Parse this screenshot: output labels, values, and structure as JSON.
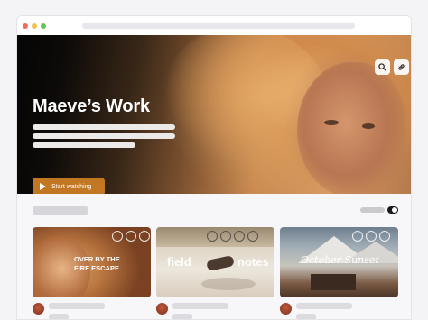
{
  "window": {
    "controls": [
      {
        "name": "close",
        "color": "#f36b5c"
      },
      {
        "name": "minimize",
        "color": "#f5bf4f"
      },
      {
        "name": "maximize",
        "color": "#5fc553"
      }
    ]
  },
  "hero": {
    "title": "Maeve’s Work",
    "cta_label": "Start watching",
    "accent": "#c27823",
    "icons": [
      "search-icon",
      "link-icon"
    ]
  },
  "cards": [
    {
      "title_lines": [
        "OVER BY THE",
        "FIRE ESCAPE"
      ]
    },
    {
      "title_left": "field",
      "title_right": "notes"
    },
    {
      "title": "October Sunset"
    }
  ]
}
